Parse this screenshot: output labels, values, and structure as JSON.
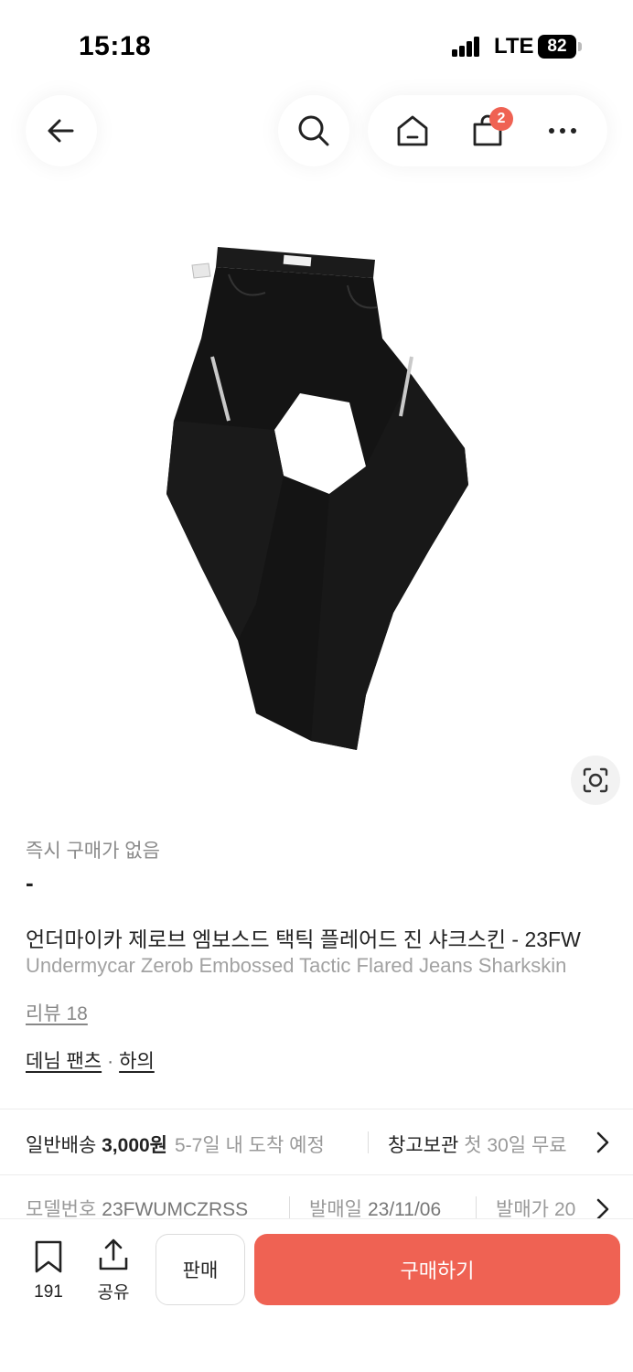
{
  "status_bar": {
    "time": "15:18",
    "network": "LTE",
    "battery": "82"
  },
  "header": {
    "cart_count": "2"
  },
  "product": {
    "instant_label": "즉시 구매가 없음",
    "price": "-",
    "title_ko": "언더마이카 제로브 엠보스드 택틱 플레어드 진 샤크스킨 - 23FW",
    "title_en": "Undermycar Zerob Embossed Tactic Flared Jeans Sharkskin",
    "review": "리뷰 18",
    "category_1": "데님 팬츠",
    "category_sep": "·",
    "category_2": "하의"
  },
  "shipping": {
    "label": "일반배송",
    "fee": "3,000원",
    "eta": "5-7일 내 도착 예정",
    "storage_label": "창고보관",
    "storage_desc": "첫 30일 무료"
  },
  "info": {
    "model_label": "모델번호",
    "model_value": "23FWUMCZRSS",
    "release_label": "발매일",
    "release_value": "23/11/06",
    "retail_label": "발매가",
    "retail_value": "20"
  },
  "bottom": {
    "bookmark_count": "191",
    "share_label": "공유",
    "sell_label": "판매",
    "buy_label": "구매하기"
  },
  "colors": {
    "accent": "#ef6253",
    "muted_text": "#999999"
  }
}
